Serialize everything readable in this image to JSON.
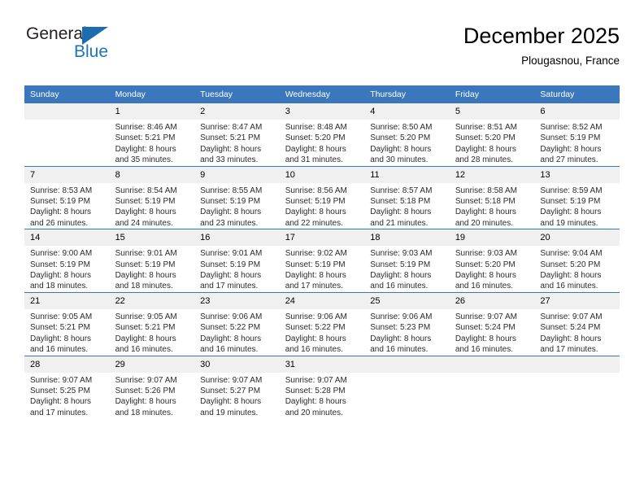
{
  "brand": {
    "line1": "General",
    "line2": "Blue",
    "triangle_color": "#1b6cb0",
    "blue_text_color": "#1b75bb"
  },
  "header": {
    "title": "December 2025",
    "location": "Plougasnou, France"
  },
  "theme": {
    "header_blue": "#3b77bd",
    "daynum_gray": "#f0f0f0"
  },
  "weekdays": [
    "Sunday",
    "Monday",
    "Tuesday",
    "Wednesday",
    "Thursday",
    "Friday",
    "Saturday"
  ],
  "weeks": [
    [
      {
        "day": "",
        "sunrise": "",
        "sunset": "",
        "daylight": "",
        "empty": true
      },
      {
        "day": "1",
        "sunrise": "Sunrise: 8:46 AM",
        "sunset": "Sunset: 5:21 PM",
        "daylight": "Daylight: 8 hours and 35 minutes."
      },
      {
        "day": "2",
        "sunrise": "Sunrise: 8:47 AM",
        "sunset": "Sunset: 5:21 PM",
        "daylight": "Daylight: 8 hours and 33 minutes."
      },
      {
        "day": "3",
        "sunrise": "Sunrise: 8:48 AM",
        "sunset": "Sunset: 5:20 PM",
        "daylight": "Daylight: 8 hours and 31 minutes."
      },
      {
        "day": "4",
        "sunrise": "Sunrise: 8:50 AM",
        "sunset": "Sunset: 5:20 PM",
        "daylight": "Daylight: 8 hours and 30 minutes."
      },
      {
        "day": "5",
        "sunrise": "Sunrise: 8:51 AM",
        "sunset": "Sunset: 5:20 PM",
        "daylight": "Daylight: 8 hours and 28 minutes."
      },
      {
        "day": "6",
        "sunrise": "Sunrise: 8:52 AM",
        "sunset": "Sunset: 5:19 PM",
        "daylight": "Daylight: 8 hours and 27 minutes."
      }
    ],
    [
      {
        "day": "7",
        "sunrise": "Sunrise: 8:53 AM",
        "sunset": "Sunset: 5:19 PM",
        "daylight": "Daylight: 8 hours and 26 minutes."
      },
      {
        "day": "8",
        "sunrise": "Sunrise: 8:54 AM",
        "sunset": "Sunset: 5:19 PM",
        "daylight": "Daylight: 8 hours and 24 minutes."
      },
      {
        "day": "9",
        "sunrise": "Sunrise: 8:55 AM",
        "sunset": "Sunset: 5:19 PM",
        "daylight": "Daylight: 8 hours and 23 minutes."
      },
      {
        "day": "10",
        "sunrise": "Sunrise: 8:56 AM",
        "sunset": "Sunset: 5:19 PM",
        "daylight": "Daylight: 8 hours and 22 minutes."
      },
      {
        "day": "11",
        "sunrise": "Sunrise: 8:57 AM",
        "sunset": "Sunset: 5:18 PM",
        "daylight": "Daylight: 8 hours and 21 minutes."
      },
      {
        "day": "12",
        "sunrise": "Sunrise: 8:58 AM",
        "sunset": "Sunset: 5:18 PM",
        "daylight": "Daylight: 8 hours and 20 minutes."
      },
      {
        "day": "13",
        "sunrise": "Sunrise: 8:59 AM",
        "sunset": "Sunset: 5:19 PM",
        "daylight": "Daylight: 8 hours and 19 minutes."
      }
    ],
    [
      {
        "day": "14",
        "sunrise": "Sunrise: 9:00 AM",
        "sunset": "Sunset: 5:19 PM",
        "daylight": "Daylight: 8 hours and 18 minutes."
      },
      {
        "day": "15",
        "sunrise": "Sunrise: 9:01 AM",
        "sunset": "Sunset: 5:19 PM",
        "daylight": "Daylight: 8 hours and 18 minutes."
      },
      {
        "day": "16",
        "sunrise": "Sunrise: 9:01 AM",
        "sunset": "Sunset: 5:19 PM",
        "daylight": "Daylight: 8 hours and 17 minutes."
      },
      {
        "day": "17",
        "sunrise": "Sunrise: 9:02 AM",
        "sunset": "Sunset: 5:19 PM",
        "daylight": "Daylight: 8 hours and 17 minutes."
      },
      {
        "day": "18",
        "sunrise": "Sunrise: 9:03 AM",
        "sunset": "Sunset: 5:19 PM",
        "daylight": "Daylight: 8 hours and 16 minutes."
      },
      {
        "day": "19",
        "sunrise": "Sunrise: 9:03 AM",
        "sunset": "Sunset: 5:20 PM",
        "daylight": "Daylight: 8 hours and 16 minutes."
      },
      {
        "day": "20",
        "sunrise": "Sunrise: 9:04 AM",
        "sunset": "Sunset: 5:20 PM",
        "daylight": "Daylight: 8 hours and 16 minutes."
      }
    ],
    [
      {
        "day": "21",
        "sunrise": "Sunrise: 9:05 AM",
        "sunset": "Sunset: 5:21 PM",
        "daylight": "Daylight: 8 hours and 16 minutes."
      },
      {
        "day": "22",
        "sunrise": "Sunrise: 9:05 AM",
        "sunset": "Sunset: 5:21 PM",
        "daylight": "Daylight: 8 hours and 16 minutes."
      },
      {
        "day": "23",
        "sunrise": "Sunrise: 9:06 AM",
        "sunset": "Sunset: 5:22 PM",
        "daylight": "Daylight: 8 hours and 16 minutes."
      },
      {
        "day": "24",
        "sunrise": "Sunrise: 9:06 AM",
        "sunset": "Sunset: 5:22 PM",
        "daylight": "Daylight: 8 hours and 16 minutes."
      },
      {
        "day": "25",
        "sunrise": "Sunrise: 9:06 AM",
        "sunset": "Sunset: 5:23 PM",
        "daylight": "Daylight: 8 hours and 16 minutes."
      },
      {
        "day": "26",
        "sunrise": "Sunrise: 9:07 AM",
        "sunset": "Sunset: 5:24 PM",
        "daylight": "Daylight: 8 hours and 16 minutes."
      },
      {
        "day": "27",
        "sunrise": "Sunrise: 9:07 AM",
        "sunset": "Sunset: 5:24 PM",
        "daylight": "Daylight: 8 hours and 17 minutes."
      }
    ],
    [
      {
        "day": "28",
        "sunrise": "Sunrise: 9:07 AM",
        "sunset": "Sunset: 5:25 PM",
        "daylight": "Daylight: 8 hours and 17 minutes."
      },
      {
        "day": "29",
        "sunrise": "Sunrise: 9:07 AM",
        "sunset": "Sunset: 5:26 PM",
        "daylight": "Daylight: 8 hours and 18 minutes."
      },
      {
        "day": "30",
        "sunrise": "Sunrise: 9:07 AM",
        "sunset": "Sunset: 5:27 PM",
        "daylight": "Daylight: 8 hours and 19 minutes."
      },
      {
        "day": "31",
        "sunrise": "Sunrise: 9:07 AM",
        "sunset": "Sunset: 5:28 PM",
        "daylight": "Daylight: 8 hours and 20 minutes."
      },
      {
        "day": "",
        "sunrise": "",
        "sunset": "",
        "daylight": "",
        "empty": true
      },
      {
        "day": "",
        "sunrise": "",
        "sunset": "",
        "daylight": "",
        "empty": true
      },
      {
        "day": "",
        "sunrise": "",
        "sunset": "",
        "daylight": "",
        "empty": true
      }
    ]
  ]
}
